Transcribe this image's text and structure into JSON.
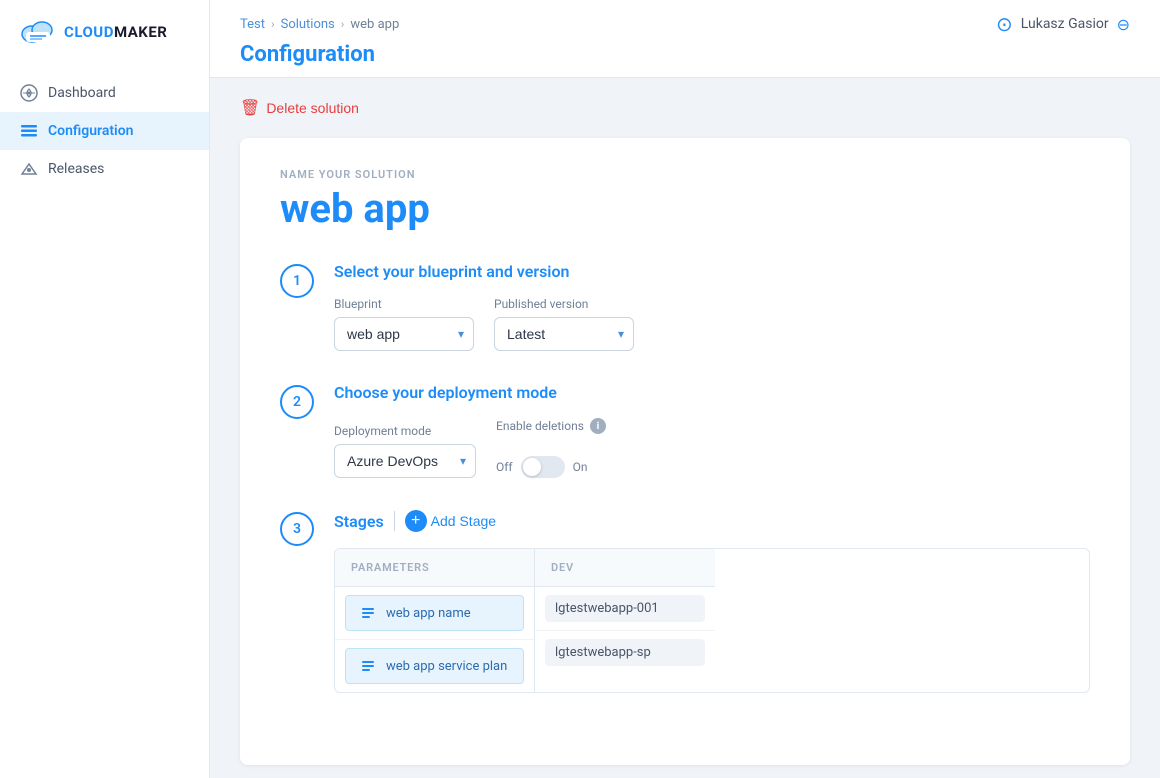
{
  "app": {
    "name": "CLOUDMAKER",
    "name_prefix": "CLOUD",
    "name_suffix": "MAKER"
  },
  "breadcrumb": {
    "items": [
      "Test",
      "Solutions",
      "web app"
    ]
  },
  "header": {
    "title": "Configuration",
    "user_name": "Lukasz Gasior"
  },
  "sidebar": {
    "items": [
      {
        "id": "dashboard",
        "label": "Dashboard",
        "active": false
      },
      {
        "id": "configuration",
        "label": "Configuration",
        "active": true
      },
      {
        "id": "releases",
        "label": "Releases",
        "active": false
      }
    ]
  },
  "delete_btn": "Delete solution",
  "solution": {
    "label": "NAME YOUR SOLUTION",
    "name": "web app"
  },
  "steps": [
    {
      "number": "1",
      "title": "Select your blueprint and version",
      "blueprint_label": "Blueprint",
      "blueprint_value": "web app",
      "version_label": "Published version",
      "version_value": "Latest"
    },
    {
      "number": "2",
      "title": "Choose your deployment mode",
      "mode_label": "Deployment mode",
      "mode_value": "Azure DevOps",
      "enable_deletions_label": "Enable deletions",
      "toggle_off": "Off",
      "toggle_on": "On"
    },
    {
      "number": "3",
      "title": "Stages",
      "add_stage_label": "Add Stage"
    }
  ],
  "stages": {
    "params_header": "PARAMETERS",
    "dev_header": "DEV",
    "params": [
      {
        "label": "web app name"
      },
      {
        "label": "web app service plan"
      }
    ],
    "dev_values": [
      {
        "value": "lgtestwebapp-001"
      },
      {
        "value": "lgtestwebapp-sp"
      }
    ]
  }
}
